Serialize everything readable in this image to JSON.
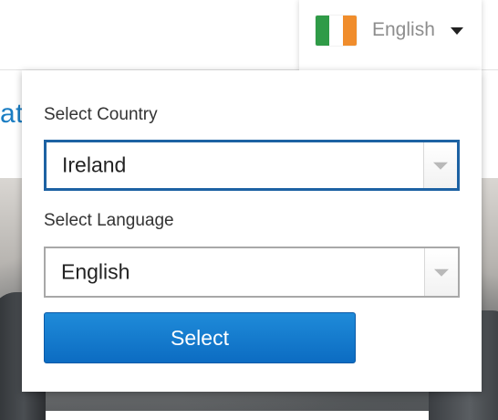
{
  "background": {
    "heading_fragment": "at"
  },
  "language_menu": {
    "flag_icon": "ireland-flag-icon",
    "current_language": "English",
    "caret_icon": "caret-down-icon"
  },
  "dropdown": {
    "country_label": "Select Country",
    "country_value": "Ireland",
    "language_label": "Select Language",
    "language_value": "English",
    "select_button_label": "Select",
    "select_arrow_icon": "chevron-down-icon"
  },
  "colors": {
    "accent_blue": "#0c6cc2",
    "focus_border": "#1d62a3",
    "flag_green": "#2f9b47",
    "flag_white": "#ffffff",
    "flag_orange": "#f08d2c"
  }
}
